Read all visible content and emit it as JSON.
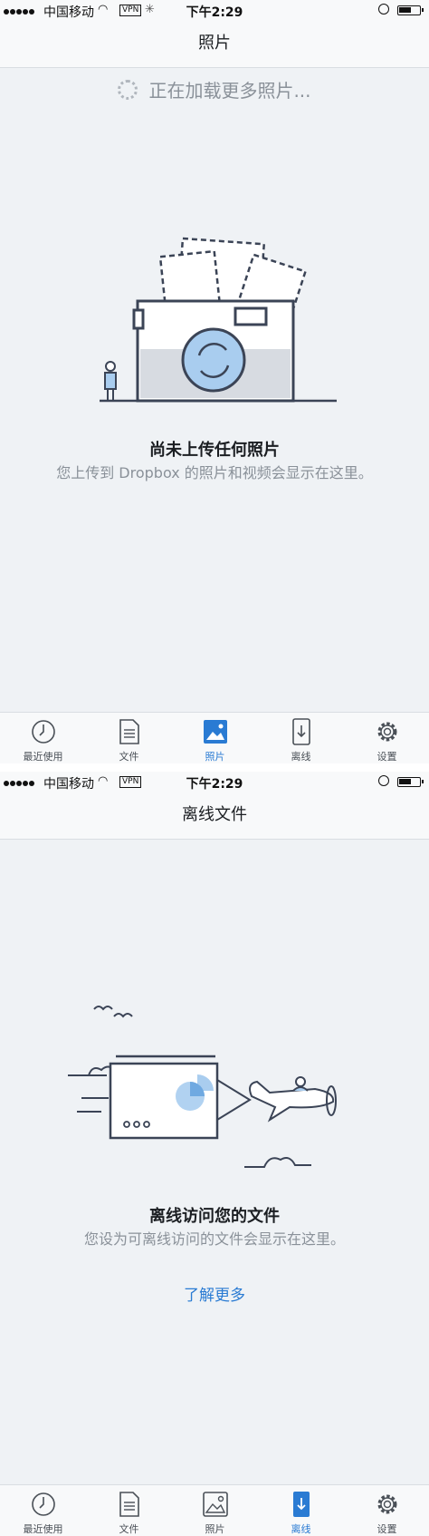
{
  "colors": {
    "accent": "#2a7bd3",
    "background": "#eff2f5",
    "text_secondary": "#8a9199"
  },
  "status_bar": {
    "carrier": "中国移动",
    "vpn": "VPN",
    "time": "下午2:29"
  },
  "screen_photos": {
    "nav_title": "照片",
    "loading_text": "正在加载更多照片...",
    "empty_title": "尚未上传任何照片",
    "empty_subtitle": "您上传到 Dropbox 的照片和视频会显示在这里。",
    "active_tab": "photos"
  },
  "screen_offline": {
    "nav_title": "离线文件",
    "empty_title": "离线访问您的文件",
    "empty_subtitle": "您设为可离线访问的文件会显示在这里。",
    "learn_more": "了解更多",
    "active_tab": "offline"
  },
  "tabs": [
    {
      "id": "recent",
      "label": "最近使用",
      "icon": "clock-icon"
    },
    {
      "id": "files",
      "label": "文件",
      "icon": "document-icon"
    },
    {
      "id": "photos",
      "label": "照片",
      "icon": "photo-icon"
    },
    {
      "id": "offline",
      "label": "离线",
      "icon": "offline-download-icon"
    },
    {
      "id": "settings",
      "label": "设置",
      "icon": "gear-icon"
    }
  ]
}
